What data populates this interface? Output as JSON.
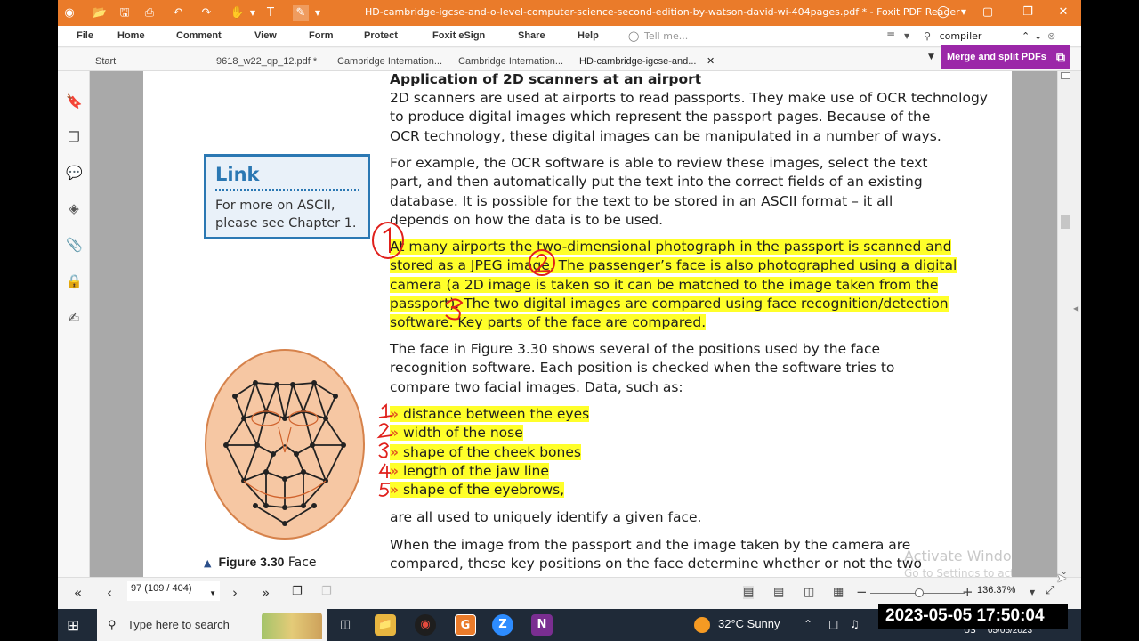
{
  "window": {
    "title": "HD-cambridge-igcse-and-o-level-computer-science-second-edition-by-watson-david-wi-404pages.pdf * - Foxit PDF Reader",
    "accent": "#ea7b2a"
  },
  "menu": [
    "File",
    "Home",
    "Comment",
    "View",
    "Form",
    "Protect",
    "Foxit eSign",
    "Share",
    "Help"
  ],
  "tell_me": "Tell me...",
  "search_value": "compiler",
  "tabs": [
    "Start",
    "9618_w22_qp_12.pdf *",
    "Cambridge Internation...",
    "Cambridge Internation...",
    "HD-cambridge-igcse-and..."
  ],
  "merge_button": "Merge and split PDFs",
  "page": {
    "heading": "Application of 2D scanners at an airport",
    "p1": [
      "2D scanners are used at airports to read passports. They make use of OCR technology",
      "to produce digital images which represent the passport pages. Because of the",
      "OCR technology, these digital images can be manipulated in a number of ways."
    ],
    "p2": [
      "For example, the OCR software is able to review these images, select the text",
      "part, and then automatically put the text into the correct fields of an existing",
      "database. It is possible for the text to be stored in an ASCII format – it all",
      "depends on how the data is to be used."
    ],
    "p3": [
      "At many airports the two-dimensional photograph in the passport is scanned and",
      "stored as a JPEG image. The passenger’s face is also photographed using a digital",
      "camera (a 2D image is taken so it can be matched to the image taken from the",
      "passport). The two digital images are compared using face recognition/detection",
      "software. Key parts of the face are compared."
    ],
    "p4": [
      "The face in Figure 3.30 shows several of the positions used by the face",
      "recognition software. Each position is checked when the software tries to",
      "compare two facial images. Data, such as:"
    ],
    "bullets": [
      "distance between the eyes",
      "width of the nose",
      "shape of the cheek bones",
      "length of the jaw line",
      "shape of the eyebrows,"
    ],
    "p5": "are all used to uniquely identify a given face.",
    "p6": [
      "When the image from the passport and the image taken by the camera are",
      "compared, these key positions on the face determine whether or not the two"
    ],
    "link_box": {
      "title": "Link",
      "body": [
        "For more on ASCII,",
        "please see Chapter 1."
      ]
    },
    "figure_caption": {
      "label": "Figure 3.30",
      "text": "Face"
    },
    "highlight_color": "#ffff2a"
  },
  "watermark": {
    "line1": "Activate Windows",
    "line2": "Go to Settings to activate Windows."
  },
  "status": {
    "page_indicator": "97 (109 / 404)",
    "zoom": "136.37%"
  },
  "taskbar": {
    "search_placeholder": "Type here to search",
    "weather": "32°C  Sunny",
    "lang": "US",
    "date": "05/05/2023"
  },
  "overlay_timestamp": "2023-05-05  17:50:04"
}
